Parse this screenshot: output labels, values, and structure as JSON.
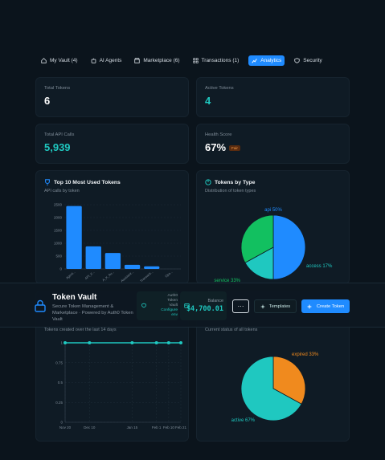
{
  "tabs": [
    {
      "label": "My Vault (4)",
      "icon": "home-icon"
    },
    {
      "label": "AI Agents",
      "icon": "bot-icon"
    },
    {
      "label": "Marketplace (6)",
      "icon": "store-icon"
    },
    {
      "label": "Transactions (1)",
      "icon": "grid-icon"
    },
    {
      "label": "Analytics",
      "icon": "chart-icon",
      "active": true
    },
    {
      "label": "Security",
      "icon": "shield-icon"
    }
  ],
  "stats": {
    "total_tokens": {
      "label": "Total Tokens",
      "value": "6"
    },
    "active_tokens": {
      "label": "Active Tokens",
      "value": "4"
    },
    "total_api_calls": {
      "label": "Total API Calls",
      "value": "5,939"
    },
    "health_score": {
      "label": "Health Score",
      "value": "67%",
      "badge": "Fair"
    }
  },
  "top_tokens_card": {
    "title": "Top 10 Most Used Tokens",
    "subtitle": "API calls by token"
  },
  "types_card": {
    "title": "Tokens by Type",
    "subtitle": "Distribution of token types"
  },
  "created_card": {
    "subtitle": "Tokens created over the last 14 days"
  },
  "status_card": {
    "subtitle": "Current status of all tokens"
  },
  "banner": {
    "title": "Token Vault",
    "subtitle": "Secure Token Management & Marketplace · Powered by Auth0 Token Vault",
    "auth_line1": "Auth0",
    "auth_line2": "Token",
    "auth_line3": "Vault",
    "auth_link": "Configure",
    "auth_line4": "env",
    "balance_label": "Balance",
    "balance_value": "$4,700.01",
    "more_label": "···",
    "templates_label": "Templates",
    "create_label": "Create Token"
  },
  "colors": {
    "accent_blue": "#1f8bff",
    "teal": "#1fc8c0",
    "green": "#12c060",
    "orange": "#f08a1e",
    "background": "#0b141c",
    "card": "#0f1b25"
  },
  "chart_data": [
    {
      "type": "bar",
      "categories": [
        "Agent...",
        "API_K...",
        "A_K_Au...",
        "Assistant...",
        "Transacti...",
        "Ops..."
      ],
      "values": [
        2450,
        880,
        620,
        160,
        100,
        0
      ],
      "yticks": [
        "0",
        "500",
        "1000",
        "1500",
        "2000",
        "2500"
      ],
      "ylim": [
        0,
        2500
      ],
      "color": "#1f8bff"
    },
    {
      "type": "pie",
      "slices": [
        {
          "label": "api 50%",
          "value": 50,
          "color": "#1f8bff"
        },
        {
          "label": "access 17%",
          "value": 17,
          "color": "#1fc8c0"
        },
        {
          "label": "service 33%",
          "value": 33,
          "color": "#12c060"
        }
      ]
    },
    {
      "type": "line",
      "x": [
        "Nov 20",
        "Nov 25",
        "Nov 30",
        "Dec 5",
        "Dec 10",
        "Dec 15",
        "Dec 20",
        "Dec 25",
        "Dec 30",
        "Jan 5",
        "Jan 10",
        "Jan 15",
        "Jan 20",
        "Jan 25",
        "Jan 30",
        "Feb 1",
        "Feb 5",
        "Feb 10",
        "Feb 15",
        "Feb 21"
      ],
      "xticks": [
        "Nov 20",
        "Dec 10",
        "Jan 15",
        "Feb 1",
        "Feb 10",
        "Feb 21"
      ],
      "values": [
        1,
        1,
        1,
        1,
        1,
        1
      ],
      "yticks": [
        "0",
        "0.25",
        "0.5",
        "0.75",
        "1"
      ],
      "ylim": [
        0,
        1
      ],
      "color": "#1fc8c0"
    },
    {
      "type": "pie",
      "slices": [
        {
          "label": "expired 33%",
          "value": 33,
          "color": "#f08a1e"
        },
        {
          "label": "active 67%",
          "value": 67,
          "color": "#1fc8c0"
        }
      ]
    }
  ]
}
